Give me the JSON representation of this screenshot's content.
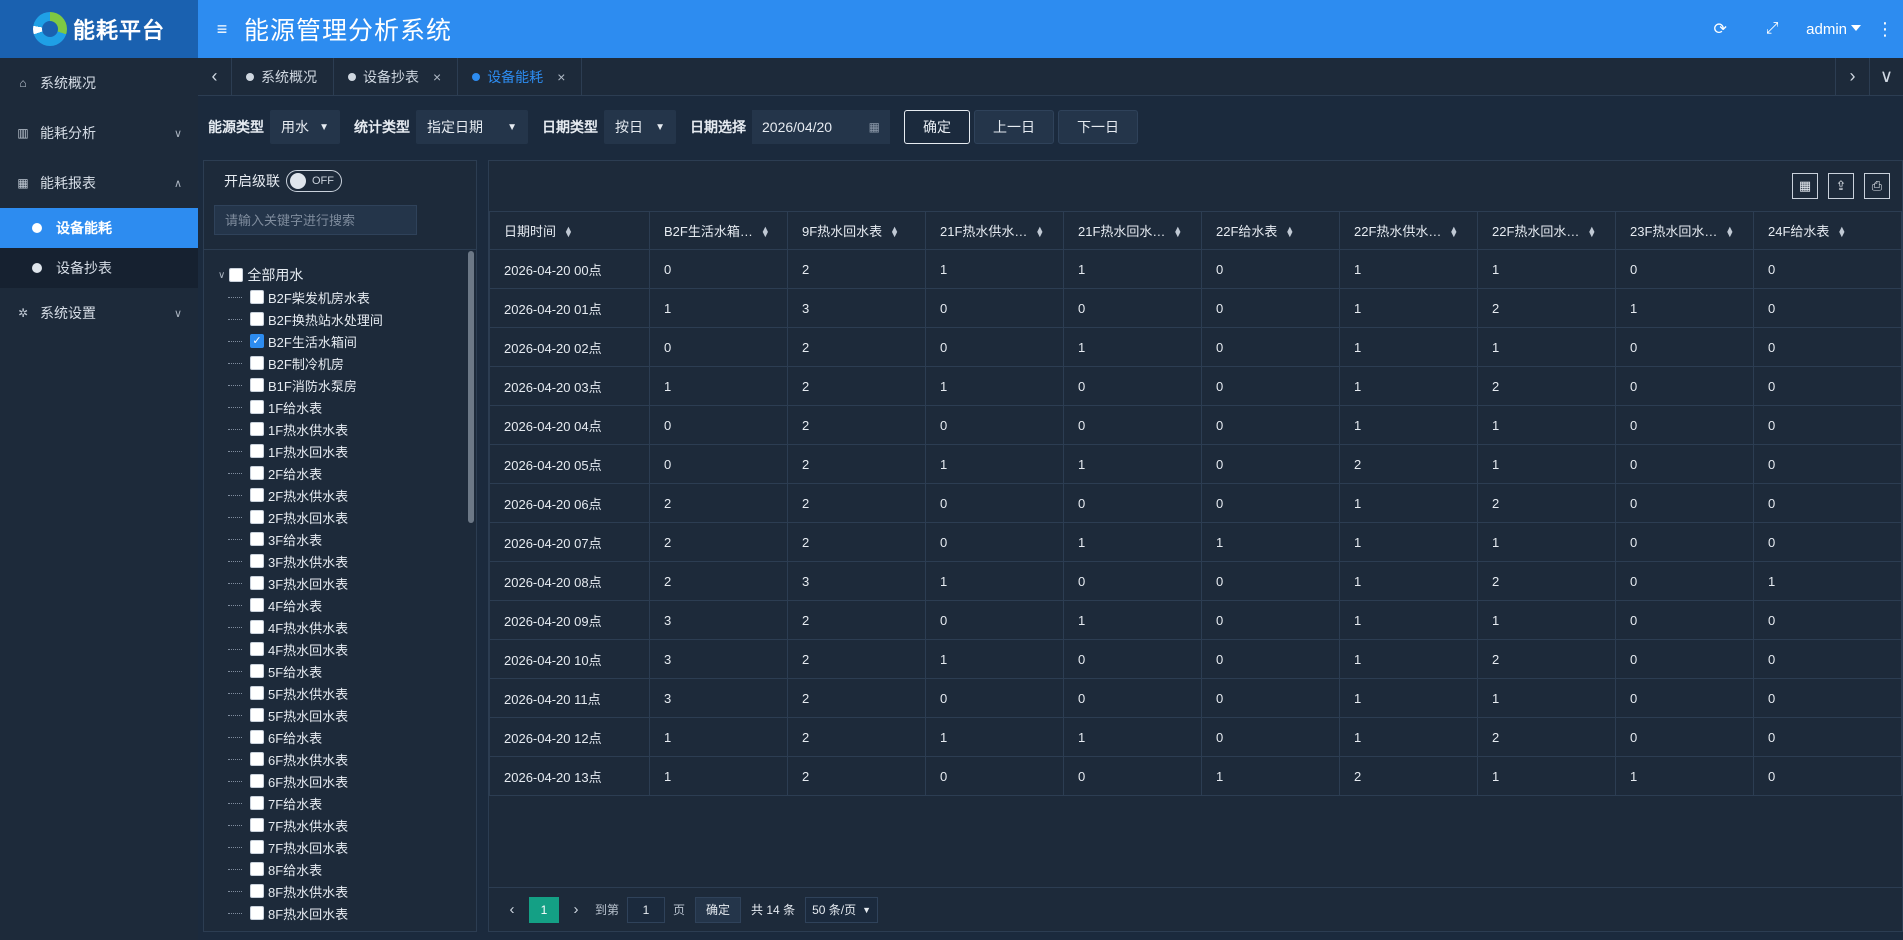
{
  "brand": {
    "name": "能耗平台"
  },
  "header": {
    "title": "能源管理分析系统",
    "user": "admin"
  },
  "sidebar": {
    "items": [
      {
        "label": "系统概况",
        "icon": "home-icon"
      },
      {
        "label": "能耗分析",
        "icon": "bar-chart-icon"
      },
      {
        "label": "能耗报表",
        "icon": "table-icon"
      },
      {
        "label": "系统设置",
        "icon": "gear-icon"
      }
    ],
    "sub_items": [
      {
        "label": "设备能耗",
        "active": true
      },
      {
        "label": "设备抄表",
        "active": false
      }
    ]
  },
  "tabs": [
    {
      "label": "系统概况",
      "closable": false,
      "active": false
    },
    {
      "label": "设备抄表",
      "closable": true,
      "active": false
    },
    {
      "label": "设备能耗",
      "closable": true,
      "active": true
    }
  ],
  "filters": {
    "energy_type": {
      "label": "能源类型",
      "value": "用水"
    },
    "stat_type": {
      "label": "统计类型",
      "value": "指定日期"
    },
    "date_type": {
      "label": "日期类型",
      "value": "按日"
    },
    "date_select": {
      "label": "日期选择",
      "value": "2026/04/20"
    },
    "confirm": "确定",
    "prev": "上一日",
    "next": "下一日"
  },
  "tree": {
    "cascade_label": "开启级联",
    "switch_text": "OFF",
    "search_placeholder": "请输入关键字进行搜索",
    "root": "全部用水",
    "nodes": [
      {
        "label": "B2F柴发机房水表",
        "checked": false
      },
      {
        "label": "B2F换热站水处理间",
        "checked": false
      },
      {
        "label": "B2F生活水箱间",
        "checked": true
      },
      {
        "label": "B2F制冷机房",
        "checked": false
      },
      {
        "label": "B1F消防水泵房",
        "checked": false
      },
      {
        "label": "1F给水表",
        "checked": false
      },
      {
        "label": "1F热水供水表",
        "checked": false
      },
      {
        "label": "1F热水回水表",
        "checked": false
      },
      {
        "label": "2F给水表",
        "checked": false
      },
      {
        "label": "2F热水供水表",
        "checked": false
      },
      {
        "label": "2F热水回水表",
        "checked": false
      },
      {
        "label": "3F给水表",
        "checked": false
      },
      {
        "label": "3F热水供水表",
        "checked": false
      },
      {
        "label": "3F热水回水表",
        "checked": false
      },
      {
        "label": "4F给水表",
        "checked": false
      },
      {
        "label": "4F热水供水表",
        "checked": false
      },
      {
        "label": "4F热水回水表",
        "checked": false
      },
      {
        "label": "5F给水表",
        "checked": false
      },
      {
        "label": "5F热水供水表",
        "checked": false
      },
      {
        "label": "5F热水回水表",
        "checked": false
      },
      {
        "label": "6F给水表",
        "checked": false
      },
      {
        "label": "6F热水供水表",
        "checked": false
      },
      {
        "label": "6F热水回水表",
        "checked": false
      },
      {
        "label": "7F给水表",
        "checked": false
      },
      {
        "label": "7F热水供水表",
        "checked": false
      },
      {
        "label": "7F热水回水表",
        "checked": false
      },
      {
        "label": "8F给水表",
        "checked": false
      },
      {
        "label": "8F热水供水表",
        "checked": false
      },
      {
        "label": "8F热水回水表",
        "checked": false
      }
    ]
  },
  "table": {
    "columns": [
      "日期时间",
      "B2F生活水箱…",
      "9F热水回水表",
      "21F热水供水…",
      "21F热水回水…",
      "22F给水表",
      "22F热水供水…",
      "22F热水回水…",
      "23F热水回水…",
      "24F给水表"
    ],
    "rows": [
      [
        "2026-04-20 00点",
        "0",
        "2",
        "1",
        "1",
        "0",
        "1",
        "1",
        "0",
        "0"
      ],
      [
        "2026-04-20 01点",
        "1",
        "3",
        "0",
        "0",
        "0",
        "1",
        "2",
        "1",
        "0"
      ],
      [
        "2026-04-20 02点",
        "0",
        "2",
        "0",
        "1",
        "0",
        "1",
        "1",
        "0",
        "0"
      ],
      [
        "2026-04-20 03点",
        "1",
        "2",
        "1",
        "0",
        "0",
        "1",
        "2",
        "0",
        "0"
      ],
      [
        "2026-04-20 04点",
        "0",
        "2",
        "0",
        "0",
        "0",
        "1",
        "1",
        "0",
        "0"
      ],
      [
        "2026-04-20 05点",
        "0",
        "2",
        "1",
        "1",
        "0",
        "2",
        "1",
        "0",
        "0"
      ],
      [
        "2026-04-20 06点",
        "2",
        "2",
        "0",
        "0",
        "0",
        "1",
        "2",
        "0",
        "0"
      ],
      [
        "2026-04-20 07点",
        "2",
        "2",
        "0",
        "1",
        "1",
        "1",
        "1",
        "0",
        "0"
      ],
      [
        "2026-04-20 08点",
        "2",
        "3",
        "1",
        "0",
        "0",
        "1",
        "2",
        "0",
        "1"
      ],
      [
        "2026-04-20 09点",
        "3",
        "2",
        "0",
        "1",
        "0",
        "1",
        "1",
        "0",
        "0"
      ],
      [
        "2026-04-20 10点",
        "3",
        "2",
        "1",
        "0",
        "0",
        "1",
        "2",
        "0",
        "0"
      ],
      [
        "2026-04-20 11点",
        "3",
        "2",
        "0",
        "0",
        "0",
        "1",
        "1",
        "0",
        "0"
      ],
      [
        "2026-04-20 12点",
        "1",
        "2",
        "1",
        "1",
        "0",
        "1",
        "2",
        "0",
        "0"
      ],
      [
        "2026-04-20 13点",
        "1",
        "2",
        "0",
        "0",
        "1",
        "2",
        "1",
        "1",
        "0"
      ]
    ]
  },
  "pager": {
    "current": "1",
    "goto_label": "到第",
    "page_input": "1",
    "page_unit": "页",
    "confirm": "确定",
    "total": "共 14 条",
    "page_size": "50 条/页"
  }
}
